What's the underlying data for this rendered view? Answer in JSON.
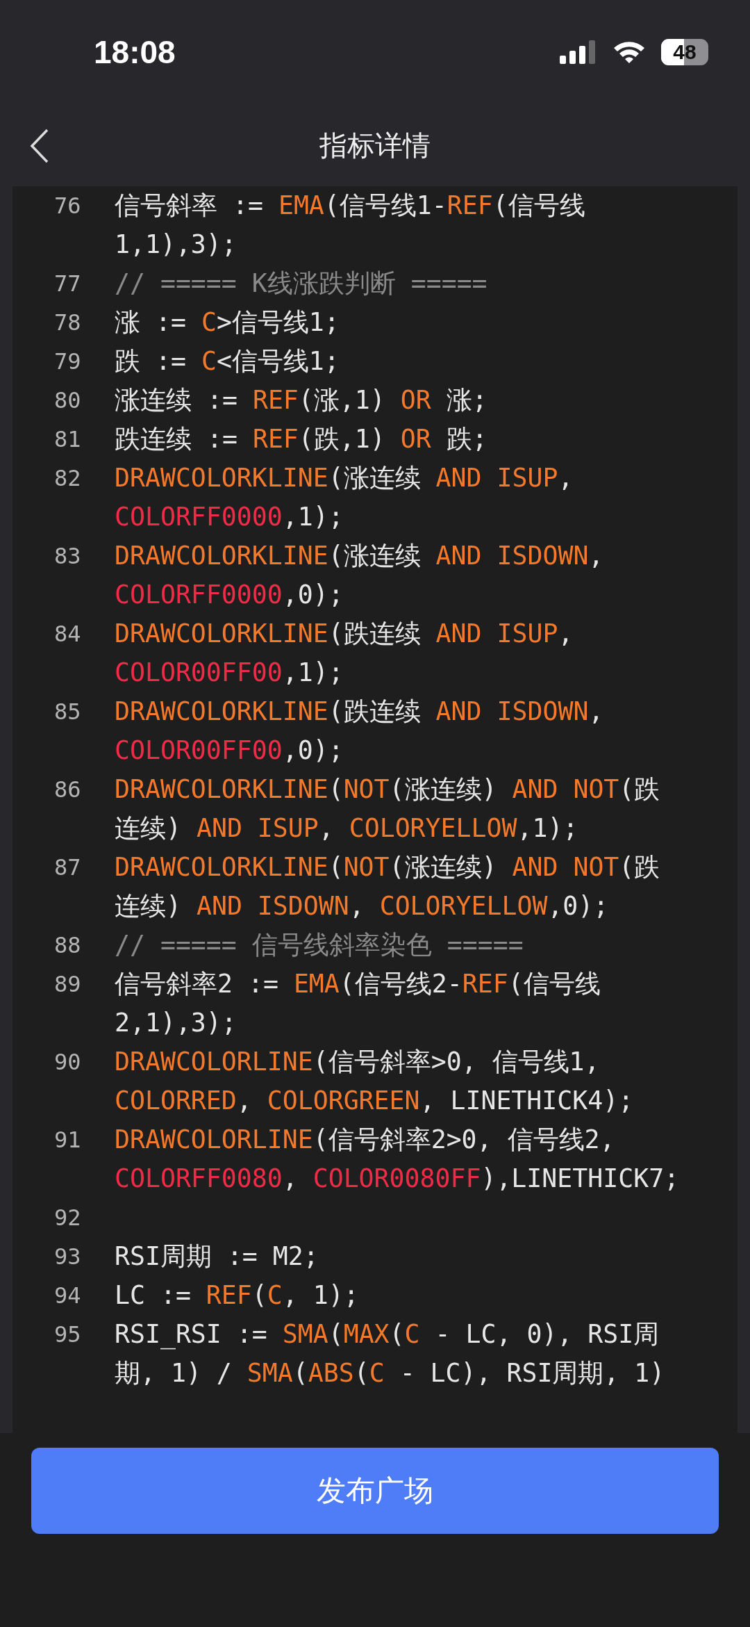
{
  "status_bar": {
    "time": "18:08",
    "battery": "48"
  },
  "nav": {
    "title": "指标详情"
  },
  "code": [
    {
      "number": "76",
      "kind": "code",
      "wraps": [
        {
          "spans": [
            {
              "kind": "plain",
              "text": "信号斜率 := "
            },
            {
              "kind": "func",
              "text": "EMA"
            },
            {
              "kind": "plain",
              "text": "(信号线1-"
            },
            {
              "kind": "func",
              "text": "REF"
            },
            {
              "kind": "plain",
              "text": "(信号线"
            }
          ]
        },
        {
          "spans": [
            {
              "kind": "plain",
              "text": "1,1),3);"
            }
          ]
        }
      ]
    },
    {
      "number": "77",
      "kind": "code",
      "wraps": [
        {
          "spans": [
            {
              "kind": "comment",
              "text": "// ===== K线涨跌判断 ====="
            }
          ]
        }
      ]
    },
    {
      "number": "78",
      "kind": "code",
      "wraps": [
        {
          "spans": [
            {
              "kind": "plain",
              "text": "涨 := "
            },
            {
              "kind": "func",
              "text": "C"
            },
            {
              "kind": "plain",
              "text": ">信号线1;"
            }
          ]
        }
      ]
    },
    {
      "number": "79",
      "kind": "code",
      "wraps": [
        {
          "spans": [
            {
              "kind": "plain",
              "text": "跌 := "
            },
            {
              "kind": "func",
              "text": "C"
            },
            {
              "kind": "plain",
              "text": "<信号线1;"
            }
          ]
        }
      ]
    },
    {
      "number": "80",
      "kind": "code",
      "wraps": [
        {
          "spans": [
            {
              "kind": "plain",
              "text": "涨连续 := "
            },
            {
              "kind": "func",
              "text": "REF"
            },
            {
              "kind": "plain",
              "text": "(涨,1) "
            },
            {
              "kind": "func",
              "text": "OR"
            },
            {
              "kind": "plain",
              "text": " 涨;"
            }
          ]
        }
      ]
    },
    {
      "number": "81",
      "kind": "code",
      "wraps": [
        {
          "spans": [
            {
              "kind": "plain",
              "text": "跌连续 := "
            },
            {
              "kind": "func",
              "text": "REF"
            },
            {
              "kind": "plain",
              "text": "(跌,1) "
            },
            {
              "kind": "func",
              "text": "OR"
            },
            {
              "kind": "plain",
              "text": " 跌;"
            }
          ]
        }
      ]
    },
    {
      "number": "82",
      "kind": "code",
      "wraps": [
        {
          "spans": [
            {
              "kind": "func",
              "text": "DRAWCOLORKLINE"
            },
            {
              "kind": "plain",
              "text": "(涨连续 "
            },
            {
              "kind": "func",
              "text": "AND ISUP"
            },
            {
              "kind": "plain",
              "text": ","
            }
          ]
        },
        {
          "spans": [
            {
              "kind": "color",
              "text": "COLORFF0000"
            },
            {
              "kind": "plain",
              "text": ",1);"
            }
          ]
        }
      ]
    },
    {
      "number": "83",
      "kind": "code",
      "wraps": [
        {
          "spans": [
            {
              "kind": "func",
              "text": "DRAWCOLORKLINE"
            },
            {
              "kind": "plain",
              "text": "(涨连续 "
            },
            {
              "kind": "func",
              "text": "AND ISDOWN"
            },
            {
              "kind": "plain",
              "text": ","
            }
          ]
        },
        {
          "spans": [
            {
              "kind": "color",
              "text": "COLORFF0000"
            },
            {
              "kind": "plain",
              "text": ",0);"
            }
          ]
        }
      ]
    },
    {
      "number": "84",
      "kind": "code",
      "wraps": [
        {
          "spans": [
            {
              "kind": "func",
              "text": "DRAWCOLORKLINE"
            },
            {
              "kind": "plain",
              "text": "(跌连续 "
            },
            {
              "kind": "func",
              "text": "AND ISUP"
            },
            {
              "kind": "plain",
              "text": ","
            }
          ]
        },
        {
          "spans": [
            {
              "kind": "color",
              "text": "COLOR00FF00"
            },
            {
              "kind": "plain",
              "text": ",1);"
            }
          ]
        }
      ]
    },
    {
      "number": "85",
      "kind": "code",
      "wraps": [
        {
          "spans": [
            {
              "kind": "func",
              "text": "DRAWCOLORKLINE"
            },
            {
              "kind": "plain",
              "text": "(跌连续 "
            },
            {
              "kind": "func",
              "text": "AND ISDOWN"
            },
            {
              "kind": "plain",
              "text": ","
            }
          ]
        },
        {
          "spans": [
            {
              "kind": "color",
              "text": "COLOR00FF00"
            },
            {
              "kind": "plain",
              "text": ",0);"
            }
          ]
        }
      ]
    },
    {
      "number": "86",
      "kind": "code",
      "wraps": [
        {
          "spans": [
            {
              "kind": "func",
              "text": "DRAWCOLORKLINE"
            },
            {
              "kind": "plain",
              "text": "("
            },
            {
              "kind": "func",
              "text": "NOT"
            },
            {
              "kind": "plain",
              "text": "(涨连续) "
            },
            {
              "kind": "func",
              "text": "AND NOT"
            },
            {
              "kind": "plain",
              "text": "(跌"
            }
          ]
        },
        {
          "spans": [
            {
              "kind": "plain",
              "text": "连续) "
            },
            {
              "kind": "func",
              "text": "AND ISUP"
            },
            {
              "kind": "plain",
              "text": ", "
            },
            {
              "kind": "func",
              "text": "COLORYELLOW"
            },
            {
              "kind": "plain",
              "text": ",1);"
            }
          ]
        }
      ]
    },
    {
      "number": "87",
      "kind": "code",
      "wraps": [
        {
          "spans": [
            {
              "kind": "func",
              "text": "DRAWCOLORKLINE"
            },
            {
              "kind": "plain",
              "text": "("
            },
            {
              "kind": "func",
              "text": "NOT"
            },
            {
              "kind": "plain",
              "text": "(涨连续) "
            },
            {
              "kind": "func",
              "text": "AND NOT"
            },
            {
              "kind": "plain",
              "text": "(跌"
            }
          ]
        },
        {
          "spans": [
            {
              "kind": "plain",
              "text": "连续) "
            },
            {
              "kind": "func",
              "text": "AND ISDOWN"
            },
            {
              "kind": "plain",
              "text": ", "
            },
            {
              "kind": "func",
              "text": "COLORYELLOW"
            },
            {
              "kind": "plain",
              "text": ",0);"
            }
          ]
        }
      ]
    },
    {
      "number": "88",
      "kind": "code",
      "wraps": [
        {
          "spans": [
            {
              "kind": "comment",
              "text": "// ===== 信号线斜率染色 ====="
            }
          ]
        }
      ]
    },
    {
      "number": "89",
      "kind": "code",
      "wraps": [
        {
          "spans": [
            {
              "kind": "plain",
              "text": "信号斜率2 := "
            },
            {
              "kind": "func",
              "text": "EMA"
            },
            {
              "kind": "plain",
              "text": "(信号线2-"
            },
            {
              "kind": "func",
              "text": "REF"
            },
            {
              "kind": "plain",
              "text": "(信号线"
            }
          ]
        },
        {
          "spans": [
            {
              "kind": "plain",
              "text": "2,1),3);"
            }
          ]
        }
      ]
    },
    {
      "number": "90",
      "kind": "code",
      "wraps": [
        {
          "spans": [
            {
              "kind": "func",
              "text": "DRAWCOLORLINE"
            },
            {
              "kind": "plain",
              "text": "(信号斜率>0, 信号线1,"
            }
          ]
        },
        {
          "spans": [
            {
              "kind": "func",
              "text": "COLORRED"
            },
            {
              "kind": "plain",
              "text": ", "
            },
            {
              "kind": "func",
              "text": "COLORGREEN"
            },
            {
              "kind": "plain",
              "text": ", LINETHICK4);"
            }
          ]
        }
      ]
    },
    {
      "number": "91",
      "kind": "code",
      "wraps": [
        {
          "spans": [
            {
              "kind": "func",
              "text": "DRAWCOLORLINE"
            },
            {
              "kind": "plain",
              "text": "(信号斜率2>0, 信号线2,"
            }
          ]
        },
        {
          "spans": [
            {
              "kind": "color",
              "text": "COLORFF0080"
            },
            {
              "kind": "plain",
              "text": ", "
            },
            {
              "kind": "color",
              "text": "COLOR0080FF"
            },
            {
              "kind": "plain",
              "text": "),LINETHICK7;"
            }
          ]
        }
      ]
    },
    {
      "number": "92",
      "kind": "blank"
    },
    {
      "number": "93",
      "kind": "code",
      "wraps": [
        {
          "spans": [
            {
              "kind": "plain",
              "text": "RSI周期 := M2;"
            }
          ]
        }
      ]
    },
    {
      "number": "94",
      "kind": "code",
      "wraps": [
        {
          "spans": [
            {
              "kind": "plain",
              "text": "LC := "
            },
            {
              "kind": "func",
              "text": "REF"
            },
            {
              "kind": "plain",
              "text": "("
            },
            {
              "kind": "func",
              "text": "C"
            },
            {
              "kind": "plain",
              "text": ", 1);"
            }
          ]
        }
      ]
    },
    {
      "number": "95",
      "kind": "code",
      "wraps": [
        {
          "spans": [
            {
              "kind": "plain",
              "text": "RSI_RSI := "
            },
            {
              "kind": "func",
              "text": "SMA"
            },
            {
              "kind": "plain",
              "text": "("
            },
            {
              "kind": "func",
              "text": "MAX"
            },
            {
              "kind": "plain",
              "text": "("
            },
            {
              "kind": "func",
              "text": "C"
            },
            {
              "kind": "plain",
              "text": " - LC, 0), RSI周"
            }
          ]
        },
        {
          "spans": [
            {
              "kind": "plain",
              "text": "期, 1) / "
            },
            {
              "kind": "func",
              "text": "SMA"
            },
            {
              "kind": "plain",
              "text": "("
            },
            {
              "kind": "func",
              "text": "ABS"
            },
            {
              "kind": "plain",
              "text": "("
            },
            {
              "kind": "func",
              "text": "C"
            },
            {
              "kind": "plain",
              "text": " - LC), RSI周期, 1)"
            }
          ]
        }
      ]
    }
  ],
  "publish_button": "发布广场"
}
